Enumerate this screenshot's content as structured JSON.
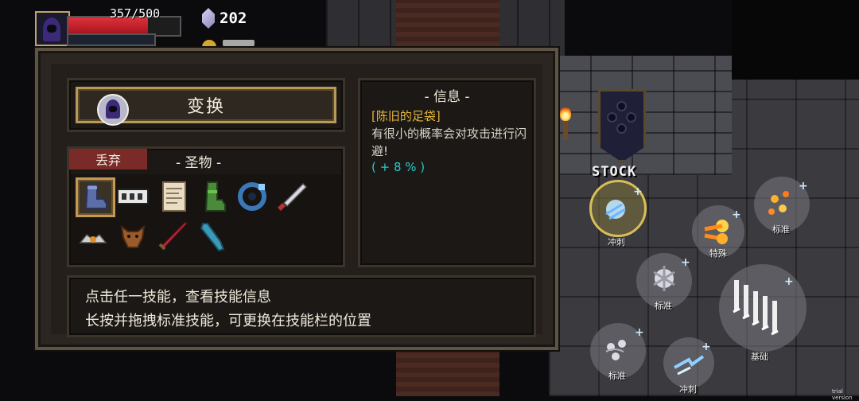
{
  "hud": {
    "hp_text": "357/500",
    "hp_fraction": 0.714,
    "gems": "202"
  },
  "panel": {
    "transform_label": "变换",
    "info_title": "- 信息 -",
    "info_item_name": "[陈旧的足袋]",
    "info_item_desc": "有很小的概率会对攻击进行闪避!",
    "info_item_effect": "( + 8 % )",
    "discard_tab": "丢弃",
    "relics_title": "- 圣物 -",
    "relics": [
      "boot-icon",
      "tape-icon",
      "scroll-icon",
      "green-boot-icon",
      "blue-ring-icon",
      "dagger-icon",
      "spiked-crown-icon",
      "boar-head-icon",
      "red-sword-icon",
      "blue-glove-icon"
    ],
    "help_line1": "点击任一技能，查看技能信息",
    "help_line2": "长按并拖拽标准技能，可更换在技能栏的位置"
  },
  "world": {
    "stock_label": "STOCK"
  },
  "skills": [
    {
      "label": "冲刺",
      "icon": "frost-dash-icon"
    },
    {
      "label": "标准",
      "icon": "fire-sparks-icon"
    },
    {
      "label": "特殊",
      "icon": "fireball-icon"
    },
    {
      "label": "标准",
      "icon": "ice-burst-icon"
    },
    {
      "label": "基础",
      "icon": "blade-rain-icon"
    },
    {
      "label": "标准",
      "icon": "wind-orbs-icon"
    },
    {
      "label": "冲刺",
      "icon": "lightning-dash-icon"
    }
  ],
  "watermark": "trial version",
  "colors": {
    "gold_border": "#b79a5a",
    "item_name": "#e4b53a",
    "effect_text": "#2fc8c8",
    "discard_tab": "#7a2b28",
    "hp": "#e0303a"
  }
}
